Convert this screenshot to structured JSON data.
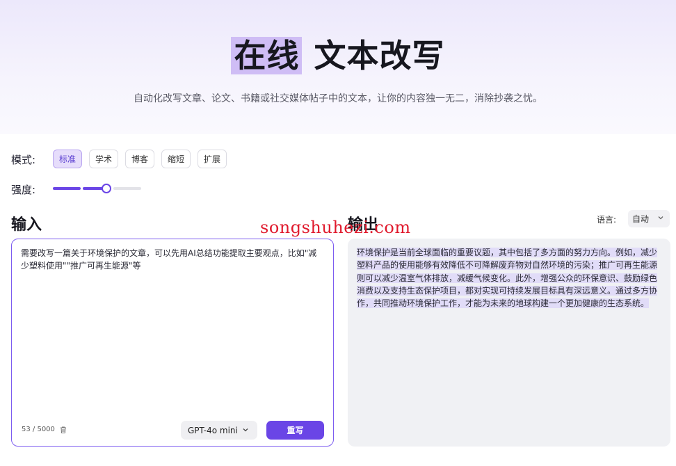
{
  "hero": {
    "title_highlight": "在线",
    "title_rest": "文本改写",
    "subtitle": "自动化改写文章、论文、书籍或社交媒体帖子中的文本，让你的内容独一无二，消除抄袭之忧。"
  },
  "mode": {
    "label": "模式:",
    "options": [
      "标准",
      "学术",
      "博客",
      "缩短",
      "扩展"
    ],
    "selected": "标准"
  },
  "strength": {
    "label": "强度:",
    "level": 2,
    "max": 3
  },
  "input": {
    "title": "输入",
    "text": "需要改写一篇关于环境保护的文章，可以先用AI总结功能提取主要观点，比如\"减少塑料使用\"\"推广可再生能源\"等",
    "counter": "53 / 5000",
    "model": "GPT-4o mini",
    "rewrite_label": "重写"
  },
  "output": {
    "title": "输出",
    "language_label": "语言:",
    "language_value": "自动",
    "text": "环境保护是当前全球面临的重要议题，其中包括了多方面的努力方向。例如，减少塑料产品的使用能够有效降低不可降解废弃物对自然环境的污染；推广可再生能源则可以减少温室气体排放，减缓气候变化。此外，增强公众的环保意识、鼓励绿色消费以及支持生态保护项目，都对实现可持续发展目标具有深远意义。通过多方协作，共同推动环境保护工作，才能为未来的地球构建一个更加健康的生态系统。"
  },
  "watermark": "songshuhezi.com",
  "colors": {
    "accent": "#6a45e6",
    "highlight": "#cfbdf5",
    "output_bg": "#f0f1f4"
  }
}
